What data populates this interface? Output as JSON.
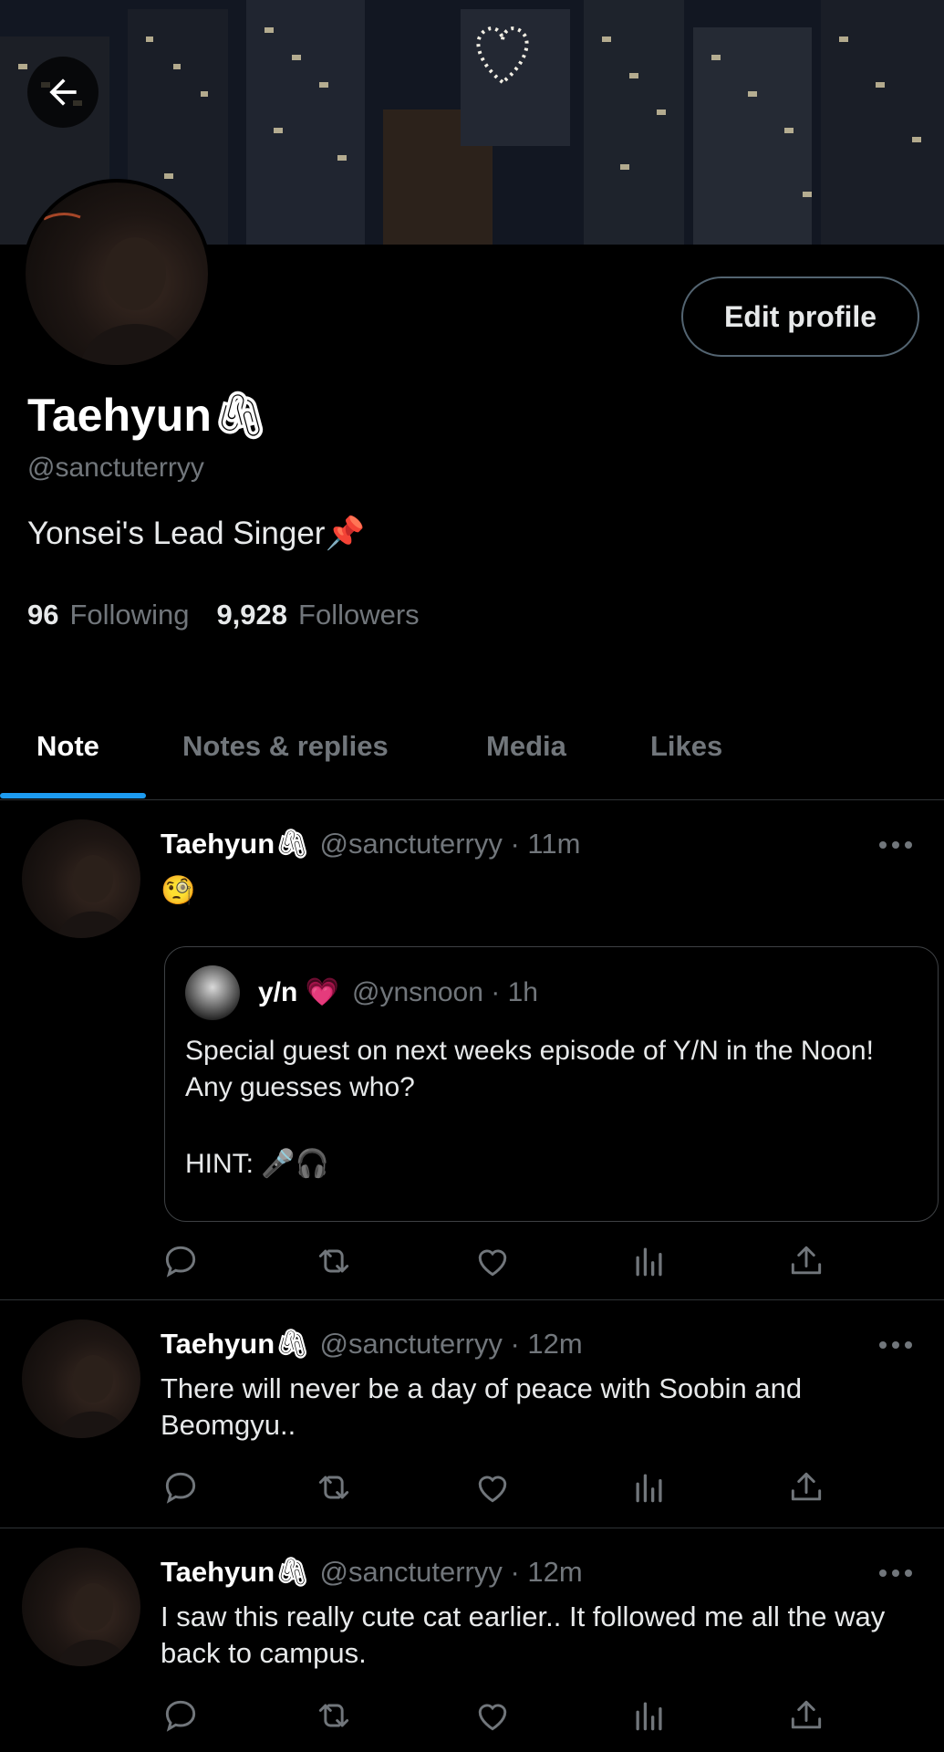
{
  "profile": {
    "name": "Taehyun🖇",
    "handle": "@sanctuterryy",
    "bio": "Yonsei's Lead Singer📌",
    "following_count": "96",
    "following_label": "Following",
    "followers_count": "9,928",
    "followers_label": "Followers",
    "edit_label": "Edit profile"
  },
  "tabs": [
    {
      "label": "Note"
    },
    {
      "label": "Notes & replies"
    },
    {
      "label": "Media"
    },
    {
      "label": "Likes"
    }
  ],
  "active_tab": "Note",
  "posts": [
    {
      "name": "Taehyun🖇",
      "meta": "@sanctuterryy · 11m",
      "text": "🧐",
      "quote": {
        "name": "y/n 💗",
        "meta": "@ynsnoon · 1h",
        "text": "Special guest on next weeks episode of Y/N in the Noon! Any guesses who?",
        "hint": "HINT: 🎤🎧"
      }
    },
    {
      "name": "Taehyun🖇",
      "meta": "@sanctuterryy · 12m",
      "text": "There will never be a day of peace with Soobin and Beomgyu.."
    },
    {
      "name": "Taehyun🖇",
      "meta": "@sanctuterryy · 12m",
      "text": "I saw this really cute cat earlier.. It followed me all the way back to campus."
    }
  ],
  "icons": {
    "back": "arrow-left-icon",
    "reply": "reply-icon",
    "retweet": "retweet-icon",
    "like": "heart-icon",
    "views": "analytics-icon",
    "share": "share-icon",
    "more": "more-icon"
  },
  "colors": {
    "background": "#000000",
    "accent": "#1d9bf0",
    "muted_text": "#71767b",
    "border": "#2f3336"
  }
}
